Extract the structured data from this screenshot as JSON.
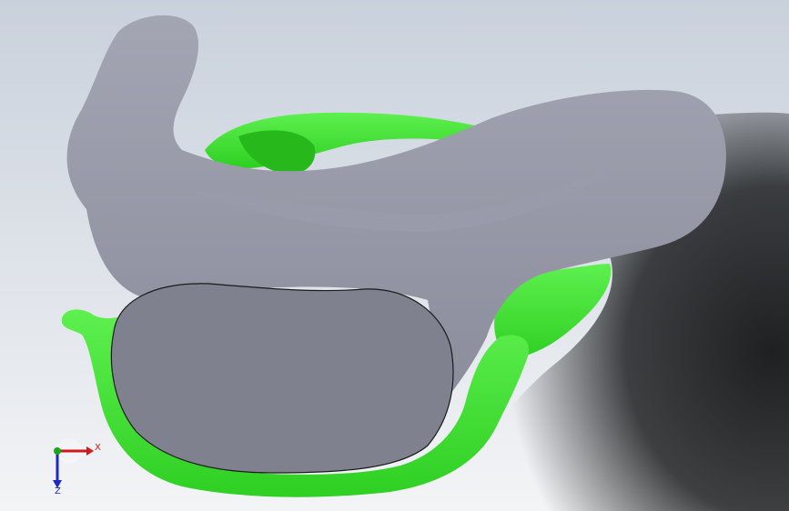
{
  "viewport": {
    "background_top": "#c9d1dc",
    "background_bottom": "#f3f4f6",
    "shadow_color": "#1e2022"
  },
  "model": {
    "body_color": "#8b8d9c",
    "body_highlight": "#a3a5b3",
    "section_face_color": "#80818f",
    "shell_color": "#2fcf23",
    "shell_highlight": "#5ef04f"
  },
  "triad": {
    "x_label": "X",
    "z_label": "Z",
    "x_color": "#d01818",
    "y_color": "#18a818",
    "z_color": "#1c2ac0"
  }
}
